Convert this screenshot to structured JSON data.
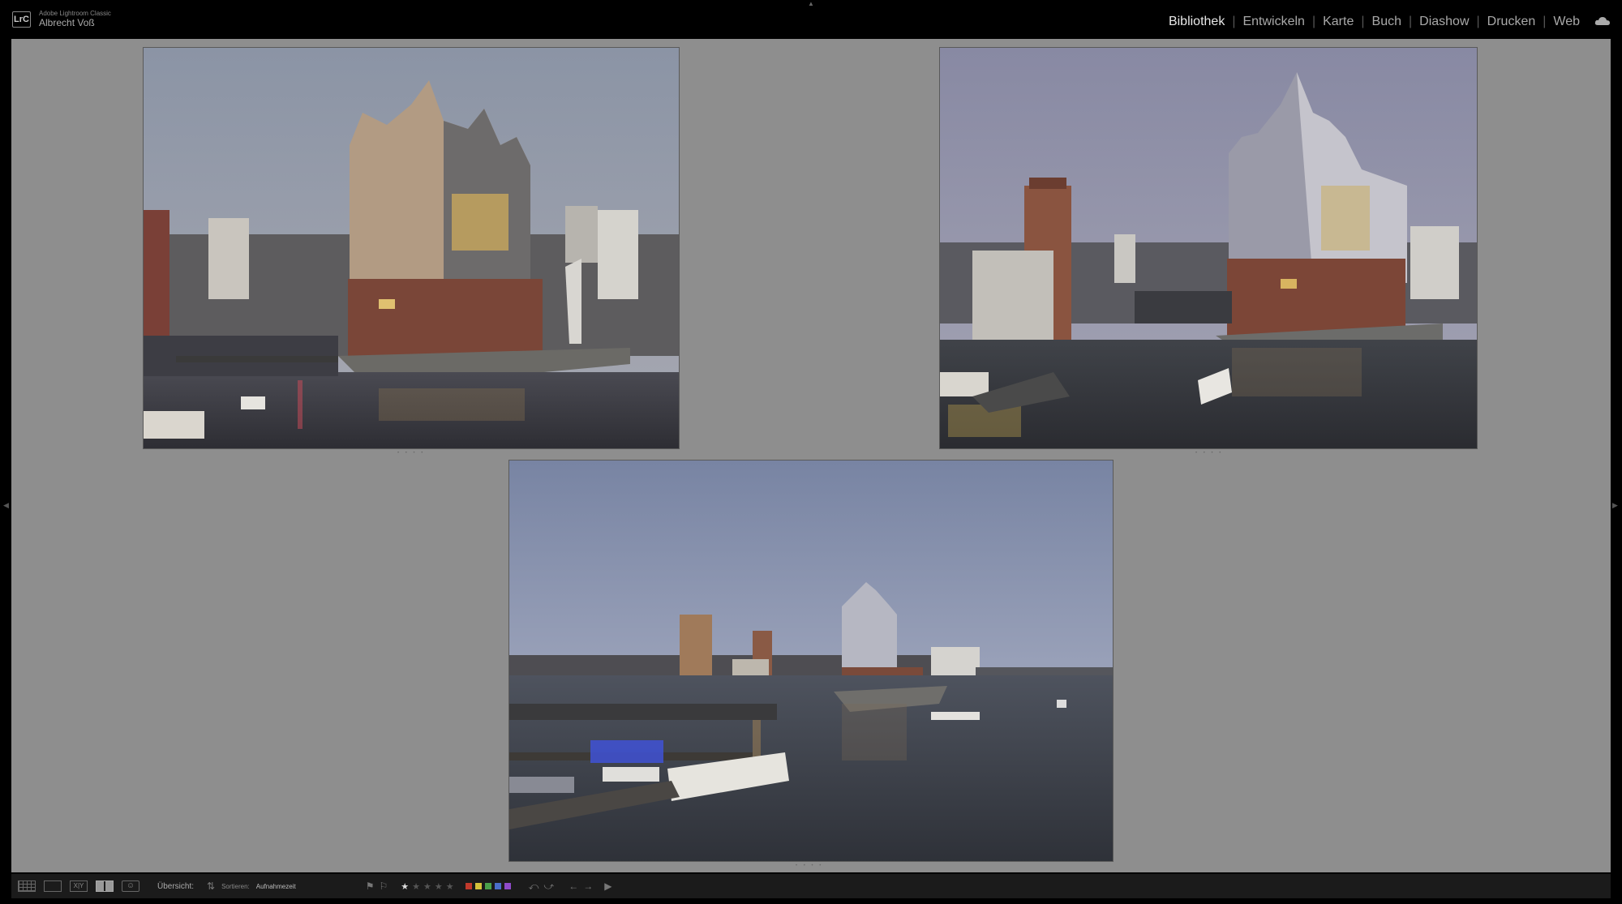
{
  "app": {
    "logo_text": "LrC",
    "name": "Adobe Lightroom Classic",
    "user": "Albrecht Voß"
  },
  "modules": [
    {
      "label": "Bibliothek",
      "active": true
    },
    {
      "label": "Entwickeln",
      "active": false
    },
    {
      "label": "Karte",
      "active": false
    },
    {
      "label": "Buch",
      "active": false
    },
    {
      "label": "Diashow",
      "active": false
    },
    {
      "label": "Drucken",
      "active": false
    },
    {
      "label": "Web",
      "active": false
    }
  ],
  "survey_photos": [
    {
      "subject": "Elbphilharmonie Hamburg – Nahaufnahme von links, Abenddämmerung"
    },
    {
      "subject": "Elbphilharmonie Hamburg – Ansicht von rechts mit Schiff"
    },
    {
      "subject": "Hamburger Hafen Panorama mit Elbphilharmonie"
    }
  ],
  "toolbar": {
    "survey_label": "Übersicht:",
    "sort_label": "Sortieren:",
    "sort_value": "Aufnahmezeit",
    "rating": 1,
    "rating_max": 5,
    "color_labels": [
      "#c0392b",
      "#d4c13a",
      "#4aa04a",
      "#4a6ec9",
      "#8e4ac9"
    ]
  },
  "colors": {
    "background_gray": "#8e8e8e",
    "panel_black": "#000000",
    "active_module": "#e8e8e8"
  }
}
